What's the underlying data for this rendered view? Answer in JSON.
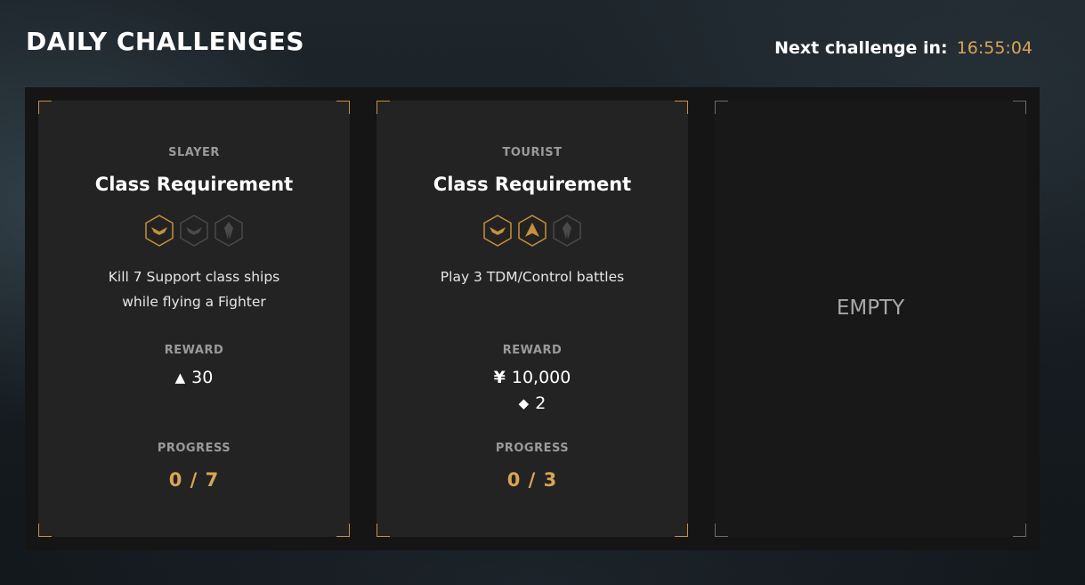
{
  "header": {
    "title": "DAILY CHALLENGES",
    "timer_label": "Next challenge in:",
    "timer_value": "16:55:04"
  },
  "colors": {
    "accent": "#d8a555",
    "card": "#232323",
    "panel": "#151515"
  },
  "cards": [
    {
      "category": "SLAYER",
      "requirement": "Class Requirement",
      "badges": [
        {
          "icon": "fighter-class-icon",
          "active": true
        },
        {
          "icon": "fighter-class-icon",
          "active": false
        },
        {
          "icon": "frigate-class-icon",
          "active": false
        }
      ],
      "description_line1": "Kill 7 Support class ships",
      "description_line2": "while flying a Fighter",
      "reward_label": "REWARD",
      "rewards": [
        {
          "icon": "triangle-icon",
          "glyph": "▲",
          "value": "30"
        }
      ],
      "progress_label": "PROGRESS",
      "progress": "0 / 7"
    },
    {
      "category": "TOURIST",
      "requirement": "Class Requirement",
      "badges": [
        {
          "icon": "fighter-class-icon",
          "active": true
        },
        {
          "icon": "interceptor-class-icon",
          "active": true
        },
        {
          "icon": "frigate-class-icon",
          "active": false
        }
      ],
      "description_line1": "Play 3 TDM/Control battles",
      "description_line2": "",
      "reward_label": "REWARD",
      "rewards": [
        {
          "icon": "yen-icon",
          "glyph": "¥",
          "value": "10,000"
        },
        {
          "icon": "diamond-icon",
          "glyph": "◆",
          "value": "2"
        }
      ],
      "progress_label": "PROGRESS",
      "progress": "0 / 3"
    },
    {
      "empty_text": "EMPTY"
    }
  ]
}
